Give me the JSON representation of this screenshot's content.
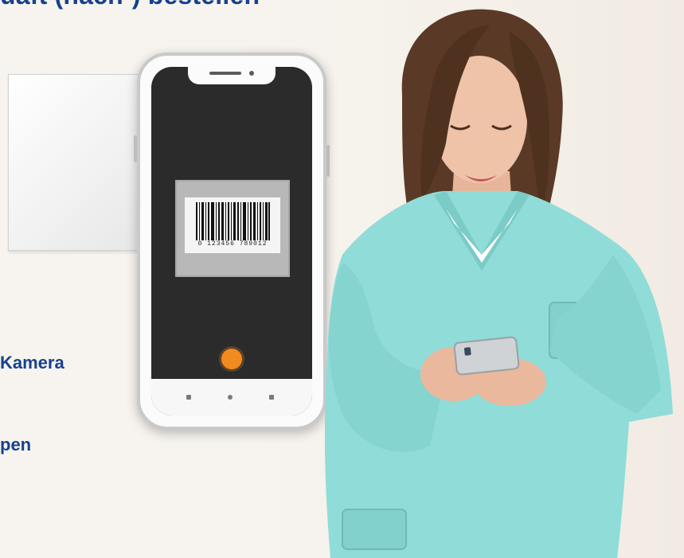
{
  "headline": "uaft (nach-) bestellen",
  "side_texts": [
    "Kamera",
    "pen"
  ],
  "phone": {
    "barcode_number": "0 123456 789012"
  },
  "colors": {
    "headline": "#17418c",
    "scrubs": "#8fdcd8",
    "shutter": "#f28b1f",
    "background": "#f7f4ef"
  },
  "icons": [
    "camera-shutter-icon",
    "barcode-icon"
  ]
}
